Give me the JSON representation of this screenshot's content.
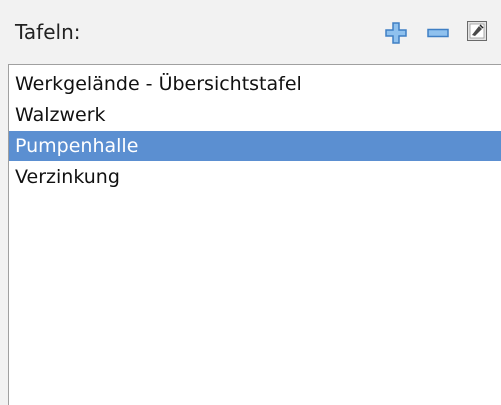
{
  "panel": {
    "label": "Tafeln:",
    "buttons": [
      {
        "name": "add",
        "icon": "plus-icon",
        "color": "#4a8cd6"
      },
      {
        "name": "remove",
        "icon": "minus-icon",
        "color": "#4a8cd6"
      },
      {
        "name": "edit",
        "icon": "edit-icon"
      }
    ]
  },
  "list": {
    "items": [
      {
        "label": "Werkgelände - Übersichtstafel",
        "selected": false
      },
      {
        "label": "Walzwerk",
        "selected": false
      },
      {
        "label": "Pumpenhalle",
        "selected": true
      },
      {
        "label": "Verzinkung",
        "selected": false
      }
    ],
    "selection_color": "#5b8fd1"
  }
}
